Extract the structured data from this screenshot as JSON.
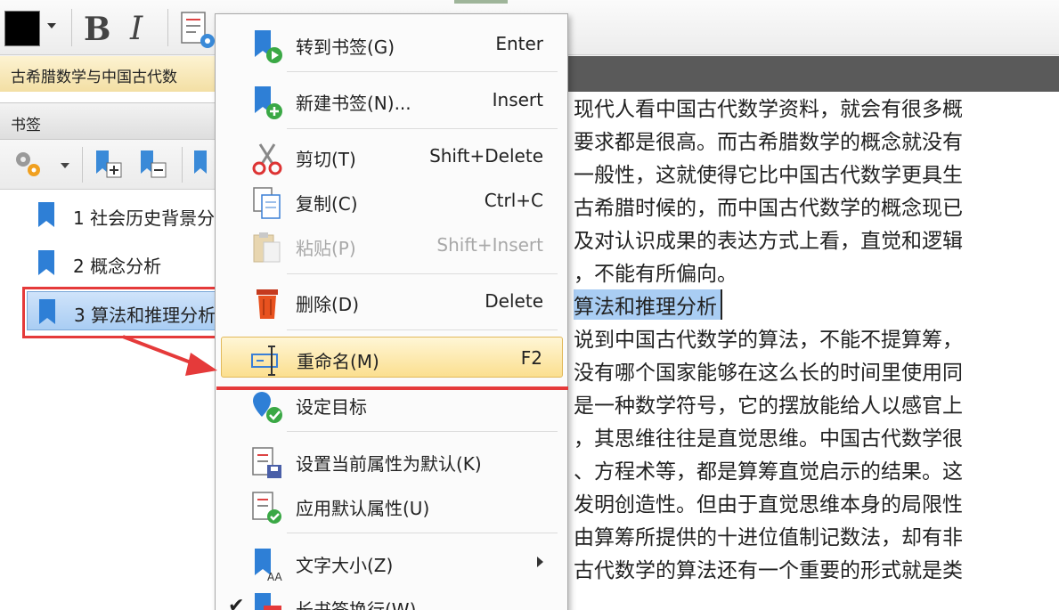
{
  "toolbar": {
    "bold_label": "B",
    "italic_label": "I",
    "color_value": "#000000"
  },
  "document_tab": {
    "title": "古希腊数学与中国古代数"
  },
  "bookmark_panel": {
    "title": "书签",
    "items": [
      {
        "label": "1 社会历史背景分"
      },
      {
        "label": "2 概念分析"
      },
      {
        "label": "3 算法和推理分析"
      }
    ]
  },
  "document": {
    "lines": [
      "现代人看中国古代数学资料，就会有很多概",
      "要求都是很高。而古希腊数学的概念就没有",
      "一般性，这就使得它比中国古代数学更具生",
      "古希腊时候的，而中国古代数学的概念现已",
      "及对认识成果的表达方式上看，直觉和逻辑",
      "，不能有所偏向。",
      "算法和推理分析",
      "说到中国古代数学的算法，不能不提算筹，",
      "没有哪个国家能够在这么长的时间里使用同",
      "是一种数学符号，它的摆放能给人以感官上",
      "，其思维往往是直觉思维。中国古代数学很",
      "、方程术等，都是算筹直觉启示的结果。这",
      "发明创造性。但由于直觉思维本身的局限性",
      "由算筹所提供的十进位值制记数法，却有非",
      "古代数学的算法还有一个重要的形式就是类"
    ]
  },
  "context_menu": {
    "items": [
      {
        "label": "转到书签(G)",
        "shortcut": "Enter",
        "icon": "goto-bookmark-icon"
      },
      {
        "label": "新建书签(N)...",
        "shortcut": "Insert",
        "icon": "new-bookmark-icon"
      },
      {
        "label": "剪切(T)",
        "shortcut": "Shift+Delete",
        "icon": "scissors-icon"
      },
      {
        "label": "复制(C)",
        "shortcut": "Ctrl+C",
        "icon": "copy-icon"
      },
      {
        "label": "粘贴(P)",
        "shortcut": "Shift+Insert",
        "icon": "paste-icon",
        "disabled": true
      },
      {
        "label": "删除(D)",
        "shortcut": "Delete",
        "icon": "trash-icon"
      },
      {
        "label": "重命名(M)",
        "shortcut": "F2",
        "icon": "rename-icon",
        "highlighted": true
      },
      {
        "label": "设定目标",
        "shortcut": "",
        "icon": "set-target-icon"
      },
      {
        "label": "设置当前属性为默认(K)",
        "shortcut": "",
        "icon": "set-default-icon"
      },
      {
        "label": "应用默认属性(U)",
        "shortcut": "",
        "icon": "apply-default-icon"
      },
      {
        "label": "文字大小(Z)",
        "shortcut": "",
        "icon": "text-size-icon",
        "submenu": true
      },
      {
        "label": "长书签换行(W)",
        "shortcut": "",
        "icon": "wrap-bookmark-icon",
        "checked": true
      }
    ]
  },
  "colors": {
    "accent_red": "#e53a3a",
    "selection_blue": "#a9cdf3",
    "menu_highlight": "#fbdf8f"
  }
}
